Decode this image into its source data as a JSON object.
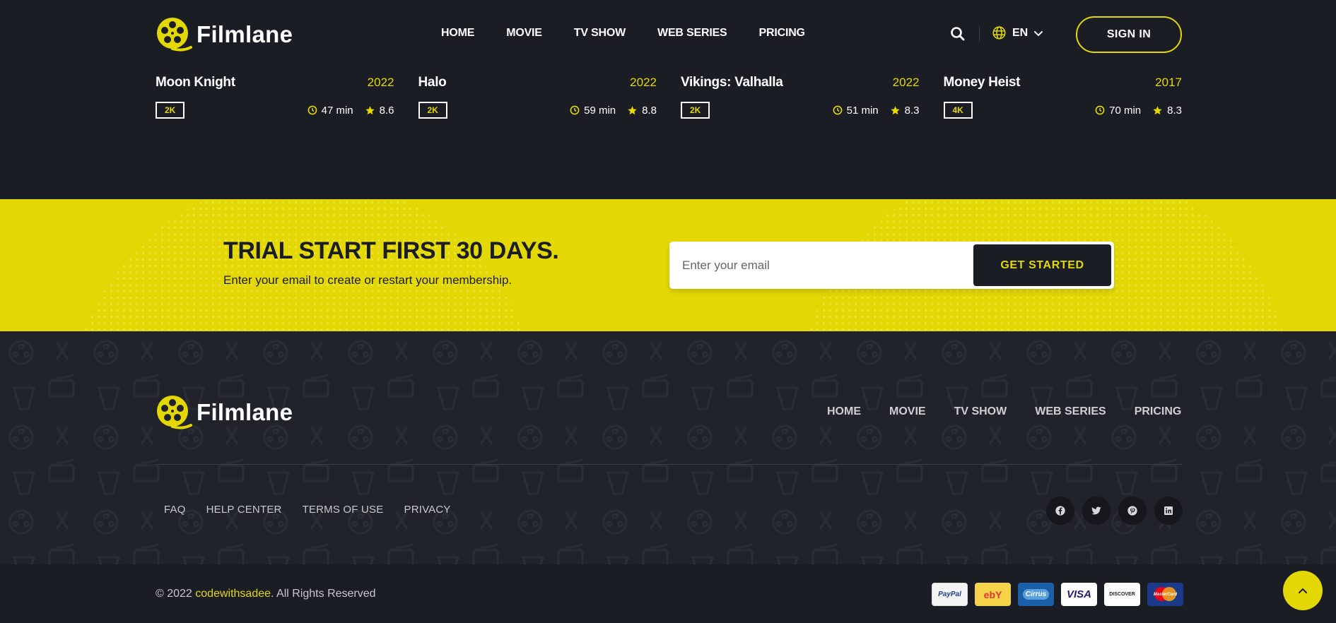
{
  "brand": {
    "name": "Filmlane"
  },
  "header": {
    "nav": [
      "HOME",
      "MOVIE",
      "TV SHOW",
      "WEB SERIES",
      "PRICING"
    ],
    "language": "EN",
    "signin_label": "SIGN IN"
  },
  "movies": [
    {
      "title": "Moon Knight",
      "year": "2022",
      "quality": "2K",
      "duration": "47 min",
      "rating": "8.6"
    },
    {
      "title": "Halo",
      "year": "2022",
      "quality": "2K",
      "duration": "59 min",
      "rating": "8.8"
    },
    {
      "title": "Vikings: Valhalla",
      "year": "2022",
      "quality": "2K",
      "duration": "51 min",
      "rating": "8.3"
    },
    {
      "title": "Money Heist",
      "year": "2017",
      "quality": "4K",
      "duration": "70 min",
      "rating": "8.3"
    }
  ],
  "newsletter": {
    "title": "TRIAL START FIRST 30 DAYS.",
    "subtitle": "Enter your email to create or restart your membership.",
    "placeholder": "Enter your email",
    "button": "GET STARTED"
  },
  "footer": {
    "nav": [
      "HOME",
      "MOVIE",
      "TV SHOW",
      "WEB SERIES",
      "PRICING"
    ],
    "links": [
      "FAQ",
      "HELP CENTER",
      "TERMS OF USE",
      "PRIVACY"
    ],
    "socials": [
      "facebook-icon",
      "twitter-icon",
      "pinterest-icon",
      "linkedin-icon"
    ],
    "copyright_prefix": "© 2022 ",
    "copyright_author": "codewithsadee",
    "copyright_suffix": ". All Rights Reserved",
    "payments": [
      "PayPal",
      "ebY",
      "Cirrus",
      "VISA",
      "DISCOVER",
      "MasterCard"
    ]
  },
  "colors": {
    "accent": "#e4d804",
    "background": "#1b1d24",
    "footer": "#21232b"
  }
}
